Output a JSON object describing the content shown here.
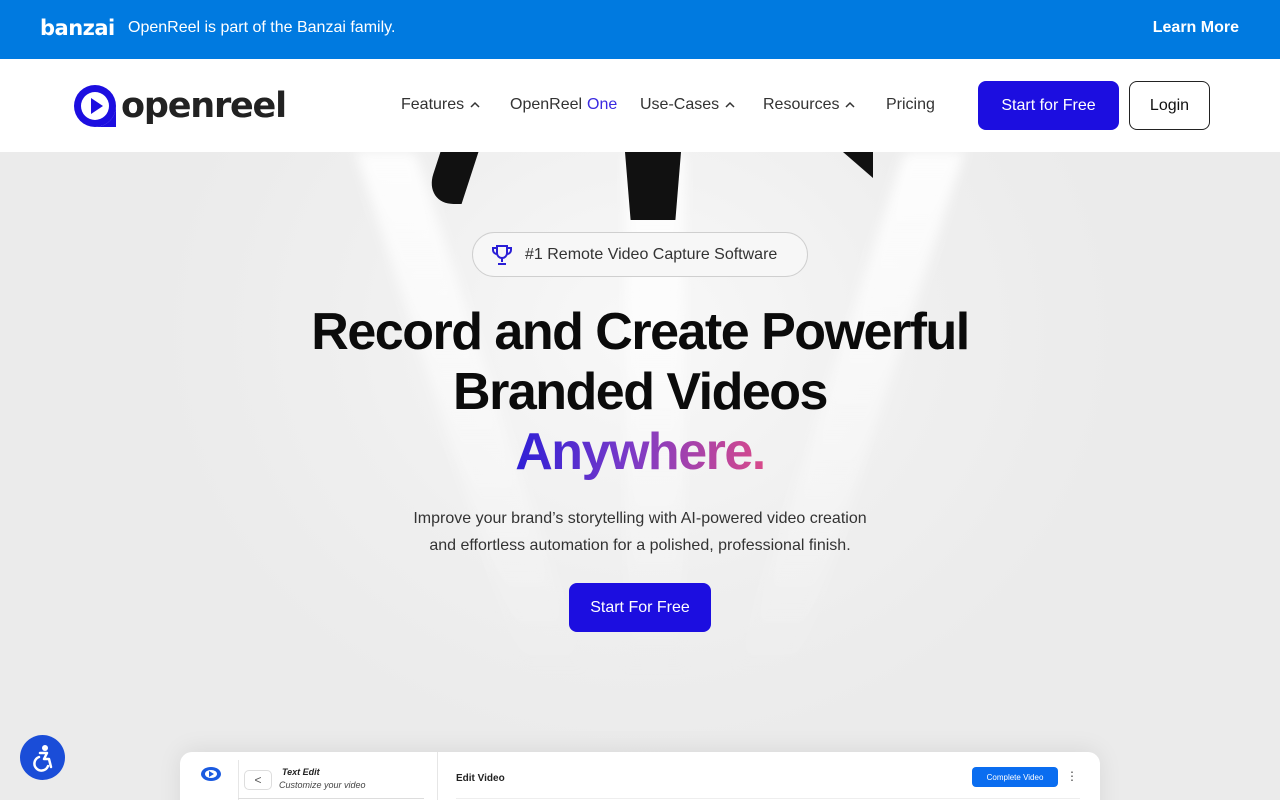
{
  "topbar": {
    "brand": "banzai",
    "message": "OpenReel is part of the Banzai family.",
    "learn_more": "Learn More",
    "bg_color": "#007ae0"
  },
  "nav": {
    "logo_text": "openreel",
    "items": [
      {
        "label": "Features",
        "has_dropdown": true
      },
      {
        "label": "OpenReel",
        "suffix": "One",
        "has_dropdown": false
      },
      {
        "label": "Use-Cases",
        "has_dropdown": true
      },
      {
        "label": "Resources",
        "has_dropdown": true
      },
      {
        "label": "Pricing",
        "has_dropdown": false
      }
    ],
    "start_button": "Start for Free",
    "login_button": "Login",
    "accent_color": "#1c0ee0"
  },
  "hero": {
    "badge_icon": "trophy-icon",
    "badge_text": "#1 Remote Video Capture Software",
    "headline_line1": "Record and Create Powerful",
    "headline_line2": "Branded Videos",
    "headline_highlight": "Anywhere.",
    "subtext_line1": "Improve your brand’s storytelling with AI-powered video creation",
    "subtext_line2": "and effortless automation for a polished, professional finish.",
    "cta": "Start For Free"
  },
  "preview": {
    "back_glyph": "<",
    "panel_title": "Text Edit",
    "panel_subtitle": "Customize your video",
    "main_title": "Edit Video",
    "complete_button": "Complete Video",
    "more_glyph": "⋮"
  },
  "accessibility": {
    "icon": "accessibility-icon"
  }
}
